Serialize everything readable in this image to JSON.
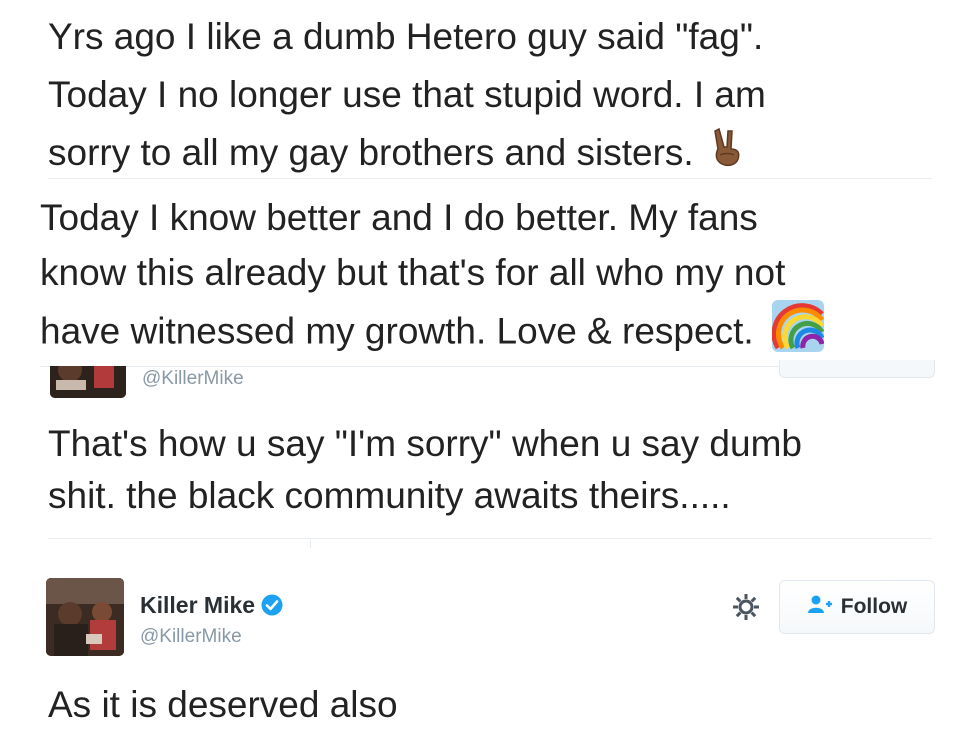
{
  "tweets": [
    {
      "lines": [
        "Yrs ago I like a dumb Hetero guy said \"fag\".",
        "Today I no longer use that stupid word.  I am",
        "sorry to all my gay brothers and sisters."
      ],
      "emoji": "victory-hand-emoji"
    },
    {
      "lines": [
        "Today I know better and I do better.  My fans",
        "know this already but that's for all who my not",
        "have witnessed my growth.  Love & respect."
      ],
      "emoji": "rainbow-emoji"
    },
    {
      "handle": "@KillerMike",
      "lines": [
        "That's how u say \"I'm sorry\" when u say dumb",
        "shit.  the black community awaits theirs....."
      ]
    },
    {
      "author": {
        "name": "Killer Mike",
        "handle": "@KillerMike",
        "verified": true
      },
      "follow_label": "Follow",
      "lines": [
        "As it is deserved also"
      ]
    }
  ],
  "colors": {
    "verified": "#1da1f2",
    "handle": "#8899a6",
    "follow_icon": "#1da1f2",
    "separator": "#e6ecf0"
  }
}
